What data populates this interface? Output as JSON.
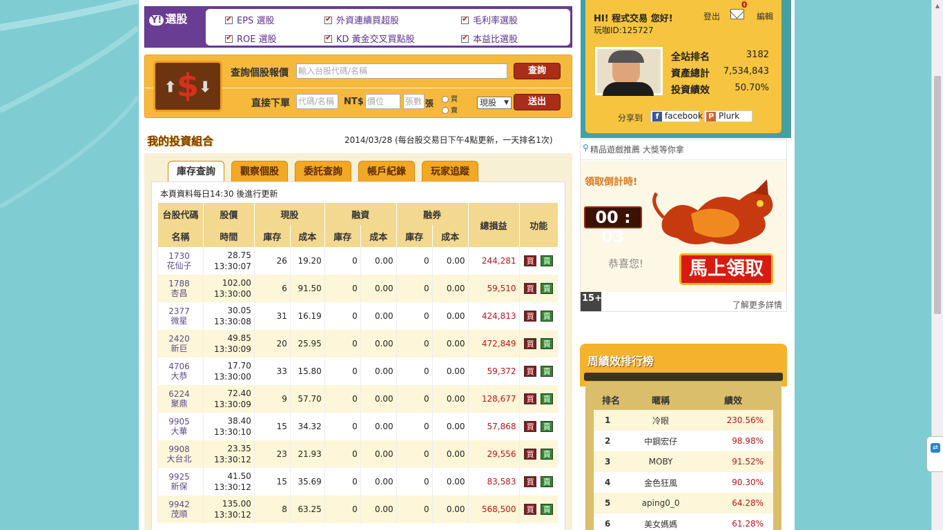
{
  "selector": {
    "logo_y": "Y!",
    "logo_text": "選股",
    "items": [
      "EPS 選股",
      "外資連續買超股",
      "毛利率選股",
      "ROE 選股",
      "KD 黃金交叉買點股",
      "本益比選股"
    ]
  },
  "quote": {
    "query_label": "查詢個股報價",
    "query_placeholder": "輸入台股代碼/名稱",
    "query_button": "查詢",
    "order_label": "直接下單",
    "code_placeholder": "代碼/名稱",
    "currency": "NT$",
    "price_placeholder": "價位",
    "qty_placeholder": "張數",
    "unit": "張",
    "buy": "買",
    "sell": "賣",
    "type": "現股",
    "submit_button": "送出"
  },
  "portfolio": {
    "title": "我的投資組合",
    "date": "2014/03/28 (每台股交易日下午4點更新，一天排名1次)",
    "tabs": [
      "庫存查詢",
      "觀察個股",
      "委託查詢",
      "帳戶紀錄",
      "玩家追蹤"
    ],
    "note": "本頁資料每日14:30 後進行更新",
    "headers": {
      "code": "台股代碼",
      "price": "股價",
      "cash": "現股",
      "margin": "融資",
      "short": "融券",
      "pl": "總損益",
      "func": "功能",
      "name": "名稱",
      "time": "時間",
      "inv": "庫存",
      "cost": "成本"
    },
    "buy_label": "買",
    "sell_label": "賣",
    "rows": [
      {
        "code": "1730",
        "name": "花仙子",
        "price": "28.75",
        "time": "13:30:07",
        "qty": "26",
        "cost": "19.20",
        "m_qty": "0",
        "m_cost": "0.00",
        "s_qty": "0",
        "s_cost": "0.00",
        "pl": "244,281"
      },
      {
        "code": "1788",
        "name": "杏昌",
        "price": "102.00",
        "time": "13:30:00",
        "qty": "6",
        "cost": "91.50",
        "m_qty": "0",
        "m_cost": "0.00",
        "s_qty": "0",
        "s_cost": "0.00",
        "pl": "59,510"
      },
      {
        "code": "2377",
        "name": "微星",
        "price": "30.05",
        "time": "13:30:08",
        "qty": "31",
        "cost": "16.19",
        "m_qty": "0",
        "m_cost": "0.00",
        "s_qty": "0",
        "s_cost": "0.00",
        "pl": "424,813"
      },
      {
        "code": "2420",
        "name": "新巨",
        "price": "49.85",
        "time": "13:30:09",
        "qty": "20",
        "cost": "25.95",
        "m_qty": "0",
        "m_cost": "0.00",
        "s_qty": "0",
        "s_cost": "0.00",
        "pl": "472,849"
      },
      {
        "code": "4706",
        "name": "大恭",
        "price": "17.70",
        "time": "13:30:00",
        "qty": "33",
        "cost": "15.80",
        "m_qty": "0",
        "m_cost": "0.00",
        "s_qty": "0",
        "s_cost": "0.00",
        "pl": "59,372"
      },
      {
        "code": "6224",
        "name": "聚鼎",
        "price": "72.40",
        "time": "13:30:09",
        "qty": "9",
        "cost": "57.70",
        "m_qty": "0",
        "m_cost": "0.00",
        "s_qty": "0",
        "s_cost": "0.00",
        "pl": "128,677"
      },
      {
        "code": "9905",
        "name": "大華",
        "price": "38.40",
        "time": "13:30:10",
        "qty": "15",
        "cost": "34.32",
        "m_qty": "0",
        "m_cost": "0.00",
        "s_qty": "0",
        "s_cost": "0.00",
        "pl": "57,868"
      },
      {
        "code": "9908",
        "name": "大台北",
        "price": "23.35",
        "time": "13:30:12",
        "qty": "23",
        "cost": "21.93",
        "m_qty": "0",
        "m_cost": "0.00",
        "s_qty": "0",
        "s_cost": "0.00",
        "pl": "29,556"
      },
      {
        "code": "9925",
        "name": "新保",
        "price": "41.50",
        "time": "13:30:12",
        "qty": "15",
        "cost": "35.69",
        "m_qty": "0",
        "m_cost": "0.00",
        "s_qty": "0",
        "s_cost": "0.00",
        "pl": "83,583"
      },
      {
        "code": "9942",
        "name": "茂順",
        "price": "135.00",
        "time": "13:30:12",
        "qty": "8",
        "cost": "63.25",
        "m_qty": "0",
        "m_cost": "0.00",
        "s_qty": "0",
        "s_cost": "0.00",
        "pl": "568,500"
      }
    ]
  },
  "user": {
    "greeting": "HI! 程式交易 您好!",
    "player_id": "玩咖ID:125727",
    "logout": "登出",
    "mail_count": "0",
    "edit": "編輯",
    "stats": [
      {
        "label": "全站排名",
        "value": "3182"
      },
      {
        "label": "資產總計",
        "value": "7,534,843"
      },
      {
        "label": "投資績效",
        "value": "50.70%"
      }
    ],
    "share_label": "分享到",
    "facebook": "facebook",
    "plurk": "Plurk"
  },
  "promo": {
    "header": "精品遊戲推薦 大獎等你拿",
    "countdown_label": "領取倒計時!",
    "countdown": "00 : 03",
    "congrats": "恭喜您!",
    "claim": "馬上領取",
    "age": "15+",
    "more": "了解更多詳情"
  },
  "ranking": {
    "title": "周績效排行榜",
    "headers": [
      "排名",
      "暱稱",
      "績效"
    ],
    "rows": [
      {
        "rank": "1",
        "name": "冷眼",
        "perf": "230.56%"
      },
      {
        "rank": "2",
        "name": "中鋼宏仔",
        "perf": "98.98%"
      },
      {
        "rank": "3",
        "name": "MOBY",
        "perf": "91.52%"
      },
      {
        "rank": "4",
        "name": "金色狂風",
        "perf": "90.30%"
      },
      {
        "rank": "5",
        "name": "aping0_0",
        "perf": "64.28%"
      },
      {
        "rank": "6",
        "name": "美女媽媽",
        "perf": "61.28%"
      }
    ]
  },
  "colors": {
    "background": "#7fcdd3",
    "accent": "#f7b93b",
    "purple": "#6a3d94",
    "profit": "#c0131b"
  }
}
